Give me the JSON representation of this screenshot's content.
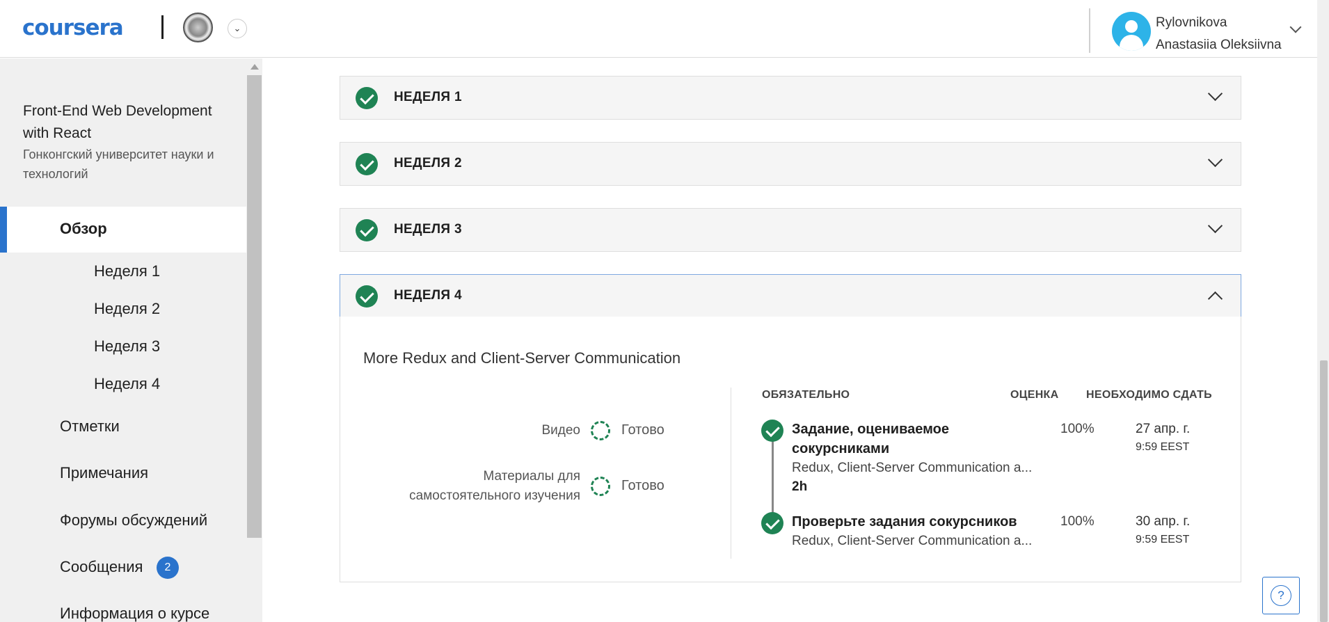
{
  "header": {
    "logo": "coursera",
    "user_name_line1": "Rylovnikova",
    "user_name_line2": "Anastasiia Oleksiivna"
  },
  "sidebar": {
    "course_title": "Front-End Web Development with React",
    "course_org": "Гонконгский университет науки и технологий",
    "items": [
      {
        "label": "Обзор"
      },
      {
        "label": "Неделя 1"
      },
      {
        "label": "Неделя 2"
      },
      {
        "label": "Неделя 3"
      },
      {
        "label": "Неделя 4"
      },
      {
        "label": "Отметки"
      },
      {
        "label": "Примечания"
      },
      {
        "label": "Форумы обсуждений"
      },
      {
        "label": "Сообщения"
      },
      {
        "label": "Информация о курсе"
      }
    ],
    "messages_badge": "2"
  },
  "weeks": [
    {
      "label": "НЕДЕЛЯ 1"
    },
    {
      "label": "НЕДЕЛЯ 2"
    },
    {
      "label": "НЕДЕЛЯ 3"
    },
    {
      "label": "НЕДЕЛЯ 4"
    }
  ],
  "week4": {
    "subtitle": "More Redux and Client-Server Communication",
    "summary": {
      "video_label": "Видео",
      "video_status": "Готово",
      "materials_label_line1": "Материалы для",
      "materials_label_line2": "самостоятельного изучения",
      "materials_status": "Готово"
    },
    "columns": {
      "required": "ОБЯЗАТЕЛЬНО",
      "grade": "ОЦЕНКА",
      "due": "НЕОБХОДИМО СДАТЬ"
    },
    "tasks": [
      {
        "title_line1": "Задание, оцениваемое",
        "title_line2": "сокурсниками",
        "description": "Redux, Client-Server Communication a...",
        "duration": "2h",
        "grade": "100%",
        "due_date": "27 апр. г.",
        "due_time": "9:59 EEST"
      },
      {
        "title_line1": "Проверьте задания сокурсников",
        "description": "Redux, Client-Server Communication a...",
        "grade": "100%",
        "due_date": "30 апр. г.",
        "due_time": "9:59 EEST"
      }
    ]
  },
  "help": {
    "icon_text": "?"
  },
  "colors": {
    "brand_blue": "#2a73cc",
    "success_green": "#1f8354"
  },
  "icons": [
    "check-circle-icon",
    "chevron-down-icon",
    "chevron-up-icon",
    "progress-ring-icon",
    "help-icon",
    "avatar-icon"
  ]
}
